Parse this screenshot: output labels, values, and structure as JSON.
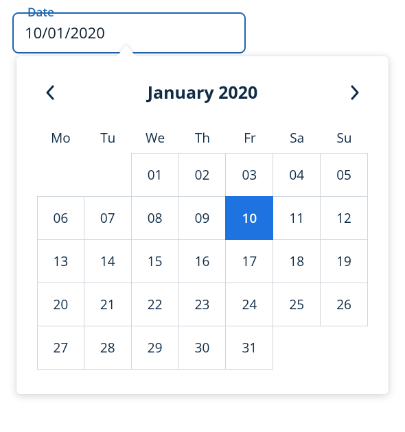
{
  "field": {
    "label": "Date",
    "value": "10/01/2020"
  },
  "calendar": {
    "title": "January 2020",
    "dow": [
      "Mo",
      "Tu",
      "We",
      "Th",
      "Fr",
      "Sa",
      "Su"
    ],
    "leading_blanks": 2,
    "days": 31,
    "selected": 10
  }
}
